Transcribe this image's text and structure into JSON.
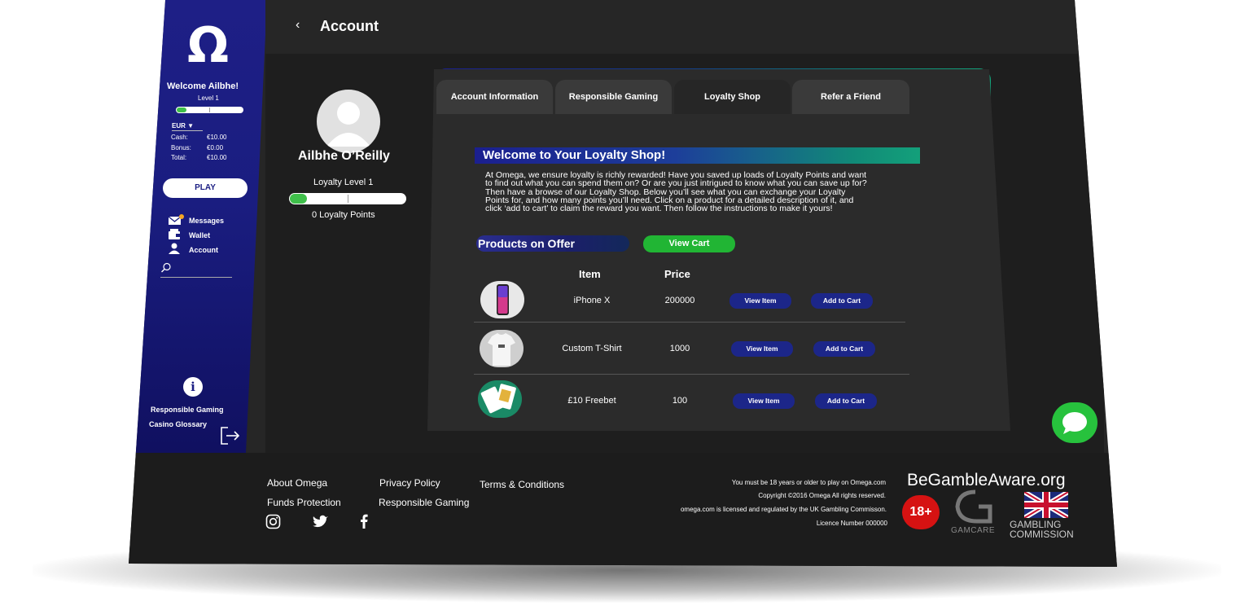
{
  "sidebar": {
    "logo": "Ω",
    "welcome": "Welcome Ailbhe!",
    "level": "Level 1",
    "currency": "EUR ▼",
    "balances": [
      {
        "label": "Cash:",
        "value": "€10.00"
      },
      {
        "label": "Bonus:",
        "value": "€0.00"
      },
      {
        "label": "Total:",
        "value": "€10.00"
      }
    ],
    "play": "PLAY",
    "messages": "Messages",
    "wallet": "Wallet",
    "account": "Account",
    "search_icon": "search-icon",
    "responsible_gaming": "Responsible Gaming",
    "casino_glossary": "Casino Glossary",
    "level_progress": 0.15
  },
  "header": {
    "back": "‹",
    "title": "Account"
  },
  "profile": {
    "name": "Ailbhe O’Reilly",
    "loyalty_level": "Loyalty Level 1",
    "loyalty_points": "0 Loyalty Points",
    "loyalty_progress": 0.15
  },
  "tabs": [
    {
      "label": "Account Information",
      "active": false
    },
    {
      "label": "Responsible Gaming",
      "active": false
    },
    {
      "label": "Loyalty Shop",
      "active": true
    },
    {
      "label": "Refer a Friend",
      "active": false
    }
  ],
  "shop": {
    "heading": "Welcome to Your Loyalty Shop!",
    "intro": "At Omega, we ensure loyalty is richly rewarded! Have you saved up loads of Loyalty Points and want to find out what you can spend them on? Or are you just intrigued to know what you can save up for? Then have a browse of our Loyalty Shop. Below you’ll see what you can exchange your Loyalty Points for, and how many points you’ll need. Click on a product for a detailed description of it, and click ‘add to cart’ to claim the reward you want. Then follow the instructions to make it yours!",
    "products_heading": "Products on Offer",
    "view_cart": "View Cart",
    "col_item": "Item",
    "col_price": "Price",
    "products": [
      {
        "item": "iPhone X",
        "price": "200000",
        "view": "View Item",
        "add": "Add to Cart"
      },
      {
        "item": "Custom T-Shirt",
        "price": "1000",
        "view": "View Item",
        "add": "Add to Cart"
      },
      {
        "item": "£10 Freebet",
        "price": "100",
        "view": "View Item",
        "add": "Add to Cart"
      }
    ]
  },
  "footer": {
    "links": {
      "about": "About Omega",
      "privacy": "Privacy Policy",
      "terms": "Terms & Conditions",
      "funds": "Funds Protection",
      "responsible": "Responsible Gaming"
    },
    "legal": [
      "You must be 18 years or older to play on Omega.com",
      "Copyright ©2016 Omega All rights reserved.",
      "omega.com is licensed and regulated by the UK Gambling Commisson.",
      "Licence Number 000000"
    ],
    "begambleaware": "BeGambleAware.org",
    "age": "18+",
    "gamcare": "GAMCARE",
    "gambling_commission_1": "GAMBLING",
    "gambling_commission_2": "COMMISSION"
  },
  "colors": {
    "sidebar": "#1e1f86",
    "accent_green": "#21b534",
    "button_blue": "#1c2689",
    "teal": "#12a37a"
  }
}
